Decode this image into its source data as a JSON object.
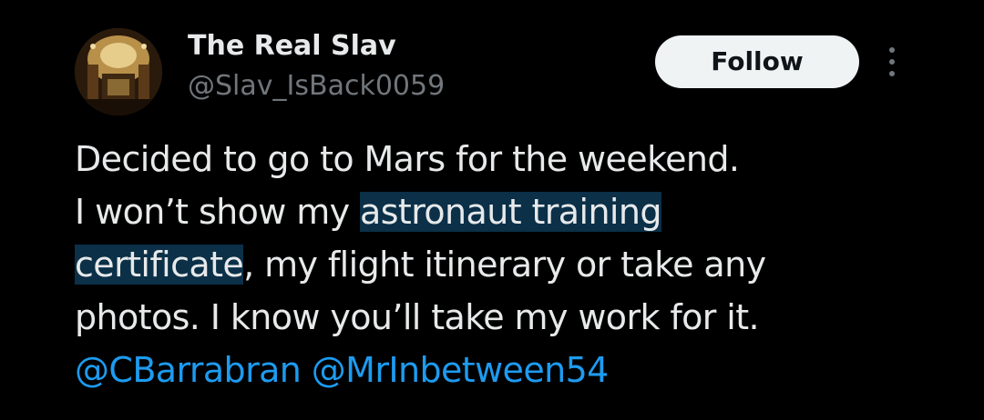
{
  "author": {
    "display_name": "The Real Slav",
    "handle": "@Slav_IsBack0059"
  },
  "actions": {
    "follow_label": "Follow",
    "more_icon": "more-vertical-icon"
  },
  "tweet": {
    "line1": "Decided to go to Mars for the weekend.",
    "line2_pre": "I won’t show my ",
    "line2_highlight": "astronaut training",
    "line3_highlight": "certificate",
    "line3_post": ", my flight itinerary or take any",
    "line4": "photos. I know you’ll take my work for it.",
    "mentions": [
      "@CBarrabran",
      "@MrInbetween54"
    ]
  },
  "colors": {
    "background": "#000000",
    "text": "#e7e9ea",
    "secondary": "#71767b",
    "link": "#1d9bf0",
    "selection": "#0b3048",
    "follow_bg": "#eff3f4"
  }
}
